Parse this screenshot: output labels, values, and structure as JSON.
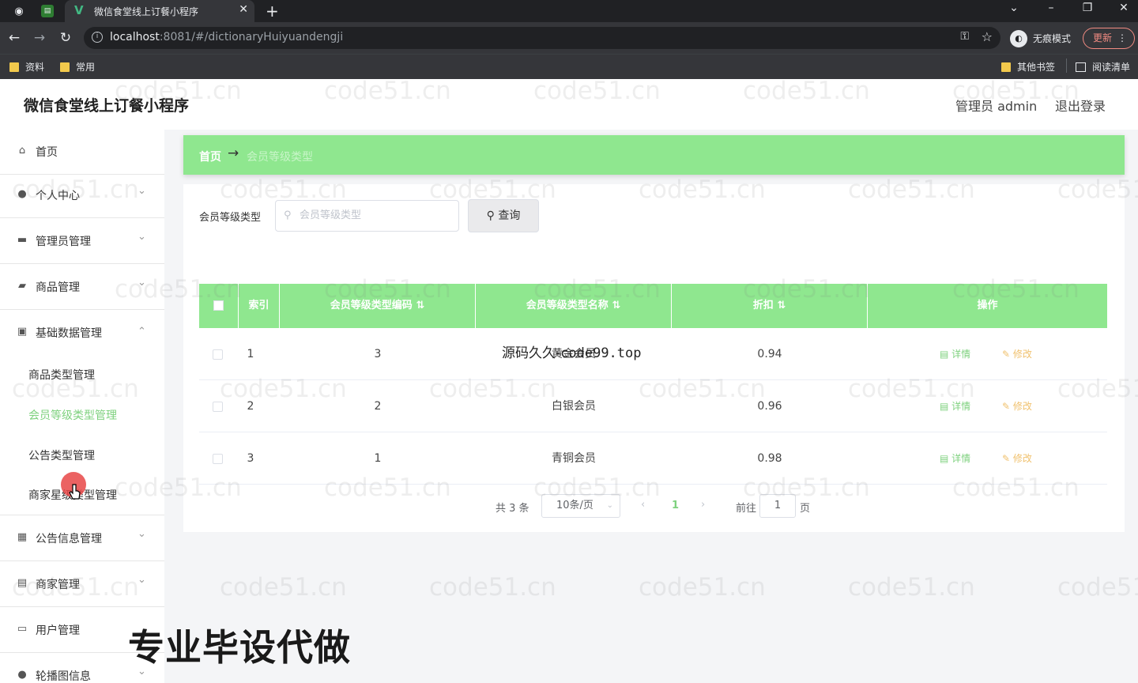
{
  "browser": {
    "tab_title": "微信食堂线上订餐小程序",
    "url_host": "localhost",
    "url_rest": ":8081/#/dictionaryHuiyuandengji",
    "incognito_label": "无痕模式",
    "update_label": "更新",
    "bookmarks": [
      "资料",
      "常用"
    ],
    "other_bookmarks": "其他书签",
    "reading_list": "阅读清单"
  },
  "app": {
    "title": "微信食堂线上订餐小程序",
    "user_label": "管理员 admin",
    "logout": "退出登录"
  },
  "sidebar": {
    "items": [
      {
        "label": "首页",
        "icon": "home-icon"
      },
      {
        "label": "个人中心",
        "icon": "user-icon"
      },
      {
        "label": "管理员管理",
        "icon": "admin-icon"
      },
      {
        "label": "商品管理",
        "icon": "goods-icon"
      },
      {
        "label": "基础数据管理",
        "icon": "data-icon"
      },
      {
        "label": "公告信息管理",
        "icon": "grid-icon"
      },
      {
        "label": "商家管理",
        "icon": "shop-icon"
      },
      {
        "label": "用户管理",
        "icon": "chat-icon"
      },
      {
        "label": "轮播图信息",
        "icon": "user-icon"
      }
    ],
    "sub_items": [
      "商品类型管理",
      "会员等级类型管理",
      "公告类型管理",
      "商家星级类型管理"
    ]
  },
  "breadcrumb": {
    "home": "首页",
    "current": "会员等级类型"
  },
  "search": {
    "label": "会员等级类型",
    "placeholder": "会员等级类型",
    "button": "查询"
  },
  "table": {
    "headers": [
      "索引",
      "会员等级类型编码",
      "会员等级类型名称",
      "折扣",
      "操作"
    ],
    "rows": [
      {
        "index": "1",
        "code": "3",
        "name": "黄金会员",
        "discount": "0.94"
      },
      {
        "index": "2",
        "code": "2",
        "name": "白银会员",
        "discount": "0.96"
      },
      {
        "index": "3",
        "code": "1",
        "name": "青铜会员",
        "discount": "0.98"
      }
    ],
    "detail_label": "详情",
    "edit_label": "修改"
  },
  "pagination": {
    "total": "共 3 条",
    "page_size": "10条/页",
    "current_page": "1",
    "goto_label": "前往",
    "goto_value": "1",
    "page_unit": "页"
  },
  "overlays": {
    "watermark": "code51.cn",
    "site_mark_cn": "源码久久-",
    "site_mark_en": "code99.top",
    "caption": "专业毕设代做"
  }
}
